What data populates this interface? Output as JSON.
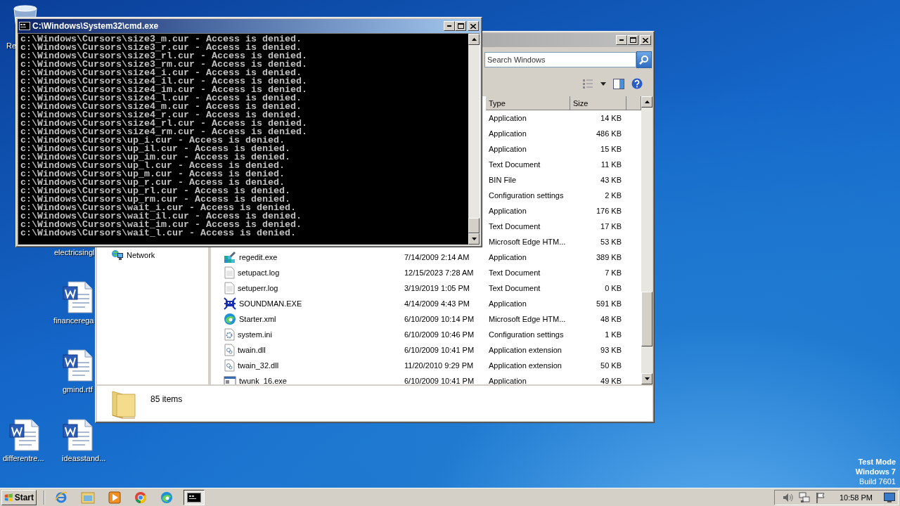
{
  "desktop": {
    "icons": [
      {
        "label": "Re",
        "kind": "recycle_bin"
      },
      {
        "label": "electricsingl",
        "kind": "covered"
      },
      {
        "label": "financerega",
        "kind": "word"
      },
      {
        "label": "gmind.rtf",
        "kind": "word"
      },
      {
        "label": "differentre...",
        "kind": "word"
      },
      {
        "label": "ideasstand...",
        "kind": "word"
      }
    ]
  },
  "explorer_window": {
    "active": false,
    "search": {
      "placeholder": "Search Windows"
    },
    "navigation": [
      {
        "label": "Network",
        "kind": "network"
      }
    ],
    "columns": [
      {
        "label": "Type"
      },
      {
        "label": "Size"
      }
    ],
    "rows": [
      {
        "type": "Application",
        "size": "14 KB"
      },
      {
        "type": "Application",
        "size": "486 KB"
      },
      {
        "type": "Application",
        "size": "15 KB"
      },
      {
        "type": "Text Document",
        "size": "11 KB"
      },
      {
        "type": "BIN File",
        "size": "43 KB"
      },
      {
        "type": "Configuration settings",
        "size": "2 KB"
      },
      {
        "type": "Application",
        "size": "176 KB"
      },
      {
        "type": "Text Document",
        "size": "17 KB"
      },
      {
        "type": "Microsoft Edge HTM...",
        "size": "53 KB"
      },
      {
        "name": "regedit.exe",
        "date": "7/14/2009 2:14 AM",
        "type": "Application",
        "size": "389 KB",
        "kind": "regedit"
      },
      {
        "name": "setupact.log",
        "date": "12/15/2023 7:28 AM",
        "type": "Text Document",
        "size": "7 KB",
        "kind": "text"
      },
      {
        "name": "setuperr.log",
        "date": "3/19/2019 1:05 PM",
        "type": "Text Document",
        "size": "0 KB",
        "kind": "text"
      },
      {
        "name": "SOUNDMAN.EXE",
        "date": "4/14/2009 4:43 PM",
        "type": "Application",
        "size": "591 KB",
        "kind": "soundman"
      },
      {
        "name": "Starter.xml",
        "date": "6/10/2009 10:14 PM",
        "type": "Microsoft Edge HTM...",
        "size": "48 KB",
        "kind": "edge"
      },
      {
        "name": "system.ini",
        "date": "6/10/2009 10:46 PM",
        "type": "Configuration settings",
        "size": "1 KB",
        "kind": "config"
      },
      {
        "name": "twain.dll",
        "date": "6/10/2009 10:41 PM",
        "type": "Application extension",
        "size": "93 KB",
        "kind": "dll"
      },
      {
        "name": "twain_32.dll",
        "date": "11/20/2010 9:29 PM",
        "type": "Application extension",
        "size": "50 KB",
        "kind": "dll"
      },
      {
        "name": "twunk_16.exe",
        "date": "6/10/2009 10:41 PM",
        "type": "Application",
        "size": "49 KB",
        "kind": "app"
      }
    ],
    "status": "85 items"
  },
  "cmd_window": {
    "title": "C:\\Windows\\System32\\cmd.exe",
    "active": true,
    "lines": [
      "c:\\Windows\\Cursors\\size3_m.cur - Access is denied.",
      "c:\\Windows\\Cursors\\size3_r.cur - Access is denied.",
      "c:\\Windows\\Cursors\\size3_rl.cur - Access is denied.",
      "c:\\Windows\\Cursors\\size3_rm.cur - Access is denied.",
      "c:\\Windows\\Cursors\\size4_i.cur - Access is denied.",
      "c:\\Windows\\Cursors\\size4_il.cur - Access is denied.",
      "c:\\Windows\\Cursors\\size4_im.cur - Access is denied.",
      "c:\\Windows\\Cursors\\size4_l.cur - Access is denied.",
      "c:\\Windows\\Cursors\\size4_m.cur - Access is denied.",
      "c:\\Windows\\Cursors\\size4_r.cur - Access is denied.",
      "c:\\Windows\\Cursors\\size4_rl.cur - Access is denied.",
      "c:\\Windows\\Cursors\\size4_rm.cur - Access is denied.",
      "c:\\Windows\\Cursors\\up_i.cur - Access is denied.",
      "c:\\Windows\\Cursors\\up_il.cur - Access is denied.",
      "c:\\Windows\\Cursors\\up_im.cur - Access is denied.",
      "c:\\Windows\\Cursors\\up_l.cur - Access is denied.",
      "c:\\Windows\\Cursors\\up_m.cur - Access is denied.",
      "c:\\Windows\\Cursors\\up_r.cur - Access is denied.",
      "c:\\Windows\\Cursors\\up_rl.cur - Access is denied.",
      "c:\\Windows\\Cursors\\up_rm.cur - Access is denied.",
      "c:\\Windows\\Cursors\\wait_i.cur - Access is denied.",
      "c:\\Windows\\Cursors\\wait_il.cur - Access is denied.",
      "c:\\Windows\\Cursors\\wait_im.cur - Access is denied.",
      "c:\\Windows\\Cursors\\wait_l.cur - Access is denied."
    ]
  },
  "taskbar": {
    "start": "Start",
    "apps": [
      {
        "kind": "ie",
        "selected": false
      },
      {
        "kind": "explorer",
        "selected": false
      },
      {
        "kind": "media",
        "selected": false
      },
      {
        "kind": "chrome",
        "selected": false
      },
      {
        "kind": "edge",
        "selected": false
      },
      {
        "kind": "cmd",
        "selected": true
      }
    ],
    "clock": "10:58 PM"
  },
  "test_mode": [
    {
      "text": "Test Mode",
      "bold": true
    },
    {
      "text": "Windows 7",
      "bold": true
    },
    {
      "text": "Build 7601",
      "bold": false
    }
  ]
}
